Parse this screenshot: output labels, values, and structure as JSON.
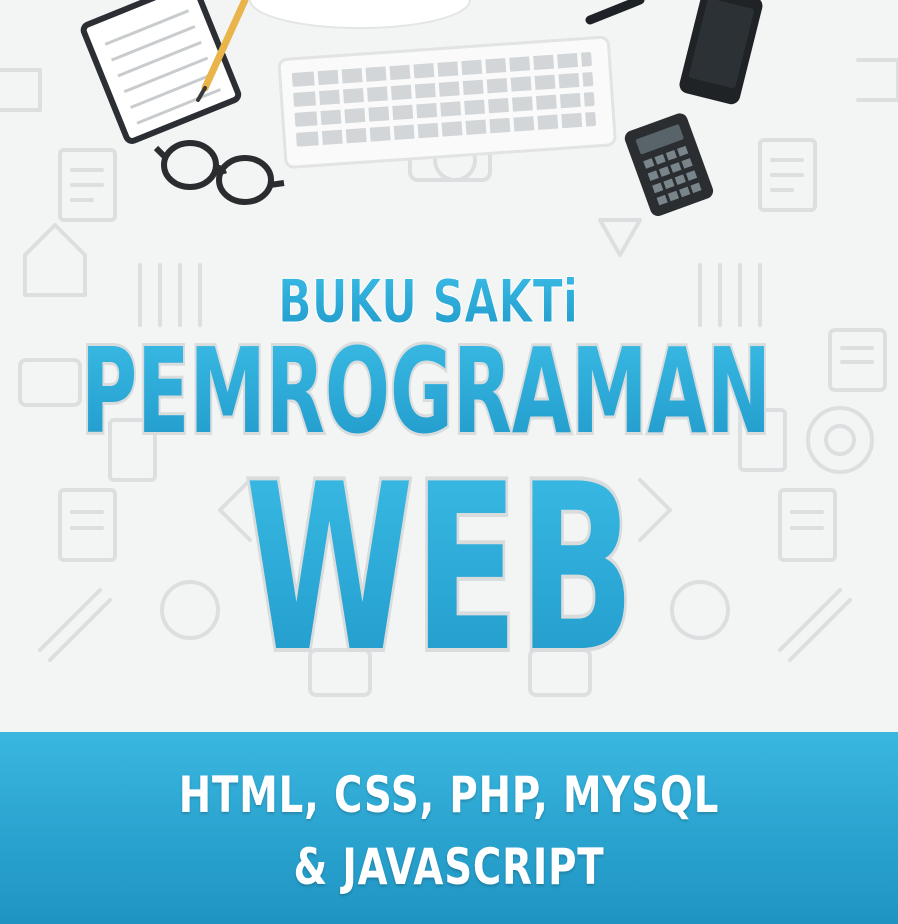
{
  "cover": {
    "kicker": "BUKU SAKTi",
    "title_line1": "PEMROGRAMAN",
    "title_line2": "WEB",
    "subtitle_line1": "HTML, CSS, PHP, MYSQL",
    "subtitle_line2": "& JAVASCRIPT"
  },
  "colors": {
    "title_blue": "#2ba9d8",
    "title_blue_dark": "#1b8fc0",
    "banner_blue": "#2aa3cf",
    "background": "#f3f4f4"
  },
  "icons": [
    "notepad-icon",
    "pencil-icon",
    "eyeglasses-icon",
    "keyboard-icon",
    "smartphone-icon",
    "calculator-icon",
    "pen-icon"
  ]
}
